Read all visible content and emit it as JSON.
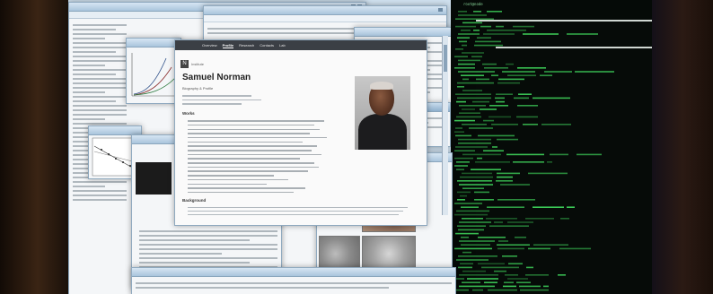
{
  "profile": {
    "nav": [
      "Overview",
      "Profile",
      "Research",
      "Contacts",
      "Lab"
    ],
    "logo_letter": "N",
    "logo_text": "Institute",
    "name": "Samuel Norman",
    "subtitle": "Biography & Profile",
    "section_publications": "Works",
    "section_footer": "Background"
  },
  "terminal": {
    "header": "root@node"
  },
  "colors": {
    "terminal_text": "#3fd35b",
    "terminal_bg": "#050a07",
    "window_chrome": "#a9c4dc",
    "profile_nav": "#3b3f45"
  }
}
